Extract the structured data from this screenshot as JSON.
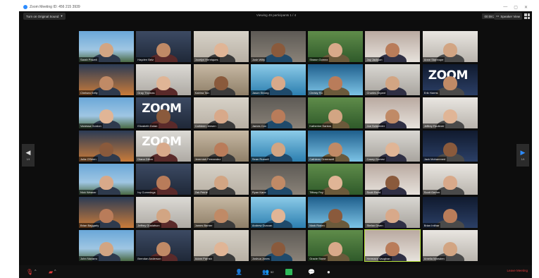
{
  "window": {
    "title": "Zoom Meeting ID: 456 215 3939",
    "controls": [
      "—",
      "▢",
      "✕"
    ]
  },
  "topbar": {
    "original_sound": "Turn on Original Sound",
    "viewing": "Viewing 49 participants 1 / 4",
    "timer": "00:08:29",
    "speaker_view": "Speaker View"
  },
  "nav": {
    "left_arrow": "◀",
    "right_arrow": "▶",
    "left_page": "1/4",
    "right_page": "1/4"
  },
  "participants": [
    "Sarah Powell",
    "Hayden Belz",
    "Jocelyn Henriques",
    "Josh Wilty",
    "Shawn Gomez",
    "Jay Jackson",
    "Anne Stanhope",
    "Chelsea Kelly",
    "Gray Thomas",
    "Katrina Tan",
    "Jason Strong",
    "Christy Ro",
    "Charles Bryant",
    "Erik Harms",
    "Vanessa Gordon",
    "Elizabeth Dolan",
    "Cathleen Jensen",
    "James Cox",
    "Katherine Santos",
    "Joe Schneider",
    "Jeffrey Faulkner",
    "Julia O'Brien",
    "Diana Dillon",
    "Jeremiah Fernandez",
    "Sean Russell",
    "Cathleen Greenwell",
    "Casey Gomez",
    "Jack Mohammed",
    "Nick Weaver",
    "Ivy Cummings",
    "Zak Petrie",
    "Ryan Kane",
    "Tiffany Fey",
    "Scott Reed",
    "Scott Gerber",
    "Brian Baggarly",
    "Jeffrey Gustafson",
    "James Barber",
    "Andrew Duncan",
    "Mark Rosen",
    "Stefan Owen",
    "Brian Intihar",
    "John Navarro",
    "Brendan Anderson",
    "Adam Parrish",
    "Joshua Jones",
    "Gracie Stone",
    "Hermaen Vaughan",
    "Amelia Marsden"
  ],
  "bottombar": {
    "mute_icon": "microphone-icon",
    "video_icon": "video-off-icon",
    "participants_count": "52",
    "leave_label": "Leave Meeting"
  }
}
